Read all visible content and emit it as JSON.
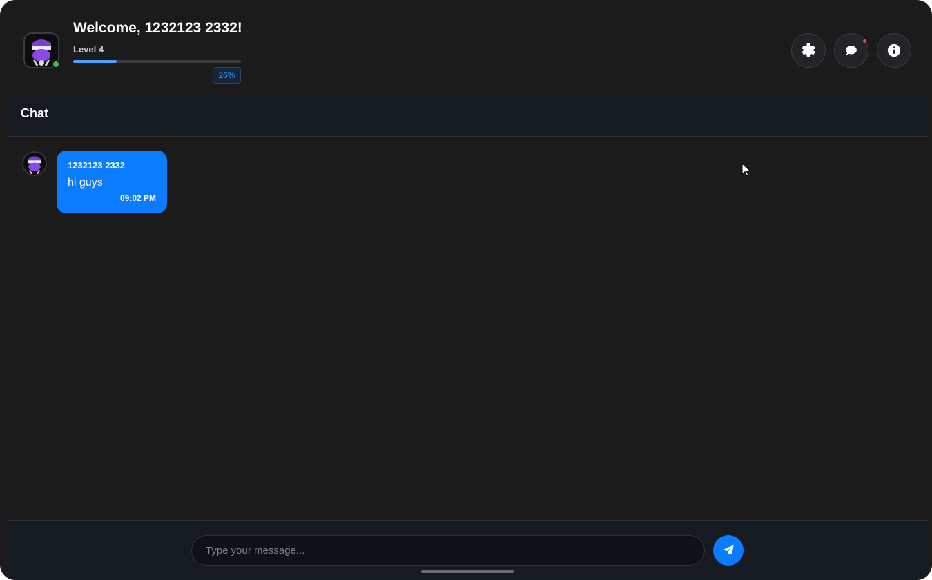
{
  "header": {
    "welcome_text": "Welcome, 1232123 2332!",
    "level_label": "Level 4",
    "xp_percent_label": "26%",
    "xp_progress": 0.26,
    "buttons": [
      {
        "icon": "gear-icon"
      },
      {
        "icon": "chat-bubble-icon"
      },
      {
        "icon": "info-icon"
      }
    ]
  },
  "chat": {
    "title": "Chat",
    "messages": [
      {
        "author": "1232123 2332",
        "text": "hi guys",
        "time": "09:02 PM"
      }
    ]
  },
  "composer": {
    "placeholder": "Type your message..."
  },
  "colors": {
    "accent": "#0a7cff",
    "background": "#1b1b1c",
    "online": "#3fb950"
  }
}
